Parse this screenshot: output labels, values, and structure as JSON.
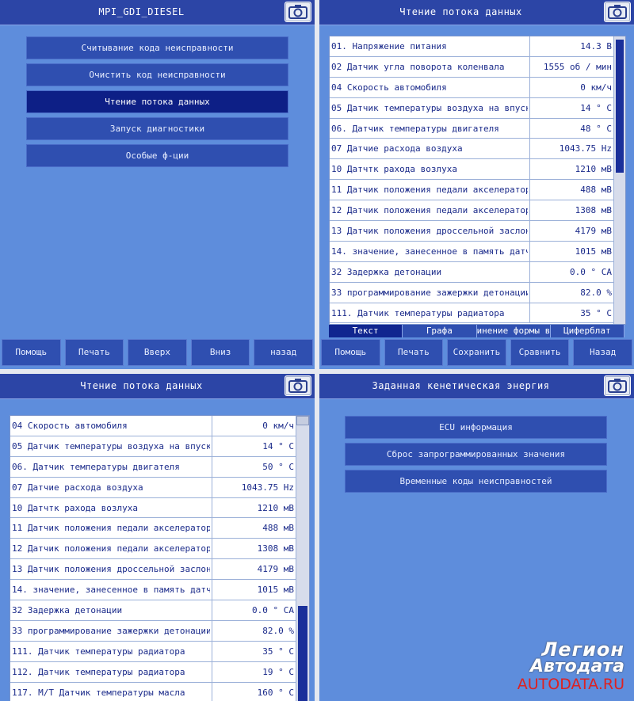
{
  "panel1": {
    "title": "MPI_GDI_DIESEL",
    "menu": [
      {
        "label": "Считывание кода неисправности"
      },
      {
        "label": "Очистить код неисправности"
      },
      {
        "label": "Чтение потока данных"
      },
      {
        "label": "Запуск диагностики"
      },
      {
        "label": "Особые ф-ции"
      }
    ],
    "bottom": [
      "Помощь",
      "Печать",
      "Вверх",
      "Вниз",
      "назад"
    ]
  },
  "panel2": {
    "title": "Чтение потока данных",
    "rows": [
      {
        "name": "01. Напряжение питания",
        "value": "14.3 В"
      },
      {
        "name": "02 Датчик угла поворота коленвала",
        "value": "1555 об / мин"
      },
      {
        "name": "04 Скорость автомобиля",
        "value": "0 км/ч"
      },
      {
        "name": "05 Датчик температуры воздуха на впуск",
        "value": "14 ° C"
      },
      {
        "name": "06. Датчик температуры двигателя",
        "value": "48 ° C"
      },
      {
        "name": "07 Датчие расхода воздуха",
        "value": "1043.75 Hz"
      },
      {
        "name": "10 Датчтк рахода возлуха",
        "value": "1210 мВ"
      },
      {
        "name": "11 Датчик положения педали акселератор",
        "value": "488 мВ"
      },
      {
        "name": "12 Датчик положения педали акселератор",
        "value": "1308 мВ"
      },
      {
        "name": "13 Датчик положения дроссельной заслон",
        "value": "4179 мВ"
      },
      {
        "name": "14. значение, занесенное в память датч",
        "value": "1015 мВ"
      },
      {
        "name": "32 Задержка детонации",
        "value": "0.0 ° CA"
      },
      {
        "name": "33 программирование зажержки детонации",
        "value": "82.0 %"
      },
      {
        "name": "111. Датчик температуры радиатора",
        "value": "35 ° C"
      }
    ],
    "tabs": [
      "Текст",
      "Графа",
      "инение формы в",
      "Циферблат"
    ],
    "bottom": [
      "Помощь",
      "Печать",
      "Сохранить",
      "Сравнить",
      "Назад"
    ]
  },
  "panel3": {
    "title": "Чтение потока данных",
    "rows": [
      {
        "name": "04 Скорость автомобиля",
        "value": "0 км/ч"
      },
      {
        "name": "05 Датчик температуры воздуха на впуск",
        "value": "14 ° C"
      },
      {
        "name": "06. Датчик температуры двигателя",
        "value": "50 ° C"
      },
      {
        "name": "07 Датчие расхода воздуха",
        "value": "1043.75 Hz"
      },
      {
        "name": "10 Датчтк рахода возлуха",
        "value": "1210 мВ"
      },
      {
        "name": "11 Датчик положения педали акселератор",
        "value": "488 мВ"
      },
      {
        "name": "12 Датчик положения педали акселератор",
        "value": "1308 мВ"
      },
      {
        "name": "13 Датчик положения дроссельной заслон",
        "value": "4179 мВ"
      },
      {
        "name": "14. значение, занесенное в память датч",
        "value": "1015 мВ"
      },
      {
        "name": "32 Задержка детонации",
        "value": "0.0 ° CA"
      },
      {
        "name": "33 программирование зажержки детонации",
        "value": "82.0 %"
      },
      {
        "name": "111. Датчик температуры радиатора",
        "value": "35 ° C"
      },
      {
        "name": "112. Датчик температуры радиатора",
        "value": "19 ° C"
      },
      {
        "name": "117. M/T Датчик температуры масла",
        "value": "160 ° C"
      }
    ]
  },
  "panel4": {
    "title": "Заданная кенетическая энергия",
    "menu": [
      {
        "label": "ECU информация"
      },
      {
        "label": "Сброс запрограммированных значения"
      },
      {
        "label": "Временные коды неисправностей"
      }
    ]
  },
  "watermark": {
    "line1": "Легион",
    "line2": "Автодата",
    "line3": "AUTODATA.RU"
  }
}
